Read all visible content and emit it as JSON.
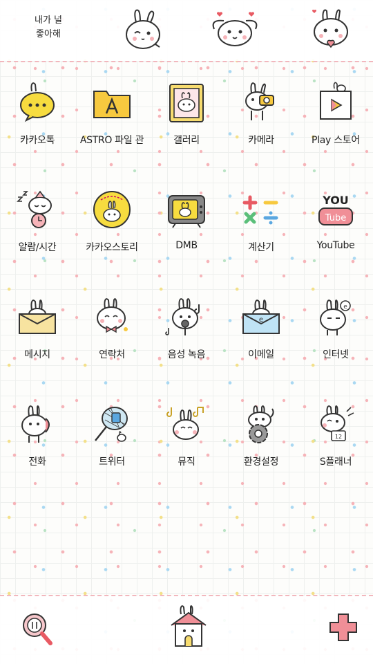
{
  "top_bar": {
    "sticker_text_line1": "내가 널",
    "sticker_text_line2": "좋아해"
  },
  "apps": [
    {
      "label": "카카오톡",
      "icon": "kakaotalk-bunny-icon"
    },
    {
      "label": "ASTRO 파일 관",
      "icon": "folder-a-icon"
    },
    {
      "label": "갤러리",
      "icon": "photo-frame-icon"
    },
    {
      "label": "카메라",
      "icon": "bunny-camera-icon"
    },
    {
      "label": "Play 스토어",
      "icon": "play-store-bag-icon"
    },
    {
      "label": "알람/시간",
      "icon": "sleeping-bunny-clock-icon"
    },
    {
      "label": "카카오스토리",
      "icon": "kakaostory-bunny-icon"
    },
    {
      "label": "DMB",
      "icon": "tv-bunny-icon"
    },
    {
      "label": "계산기",
      "icon": "calculator-symbols-icon"
    },
    {
      "label": "YouTube",
      "icon": "youtube-logo-icon"
    },
    {
      "label": "메시지",
      "icon": "bunny-envelope-icon"
    },
    {
      "label": "연락처",
      "icon": "bunny-bowtie-icon"
    },
    {
      "label": "음성 녹음",
      "icon": "bunny-microphone-icon"
    },
    {
      "label": "이메일",
      "icon": "bunny-email-icon"
    },
    {
      "label": "인터넷",
      "icon": "bunny-globe-icon"
    },
    {
      "label": "전화",
      "icon": "bunny-phone-icon"
    },
    {
      "label": "트위터",
      "icon": "butterfly-net-icon"
    },
    {
      "label": "뮤직",
      "icon": "bunny-music-icon"
    },
    {
      "label": "환경설정",
      "icon": "bunny-gear-icon"
    },
    {
      "label": "S플래너",
      "icon": "bunny-planner-icon"
    }
  ],
  "dock": {
    "search_icon": "magnifier-icon",
    "home_icon": "bunny-house-icon",
    "add_icon": "plus-icon"
  },
  "colors": {
    "accent_pink": "#f08f97",
    "accent_yellow": "#f7dc6f",
    "accent_blue": "#a9d8f2",
    "outline": "#333333"
  }
}
